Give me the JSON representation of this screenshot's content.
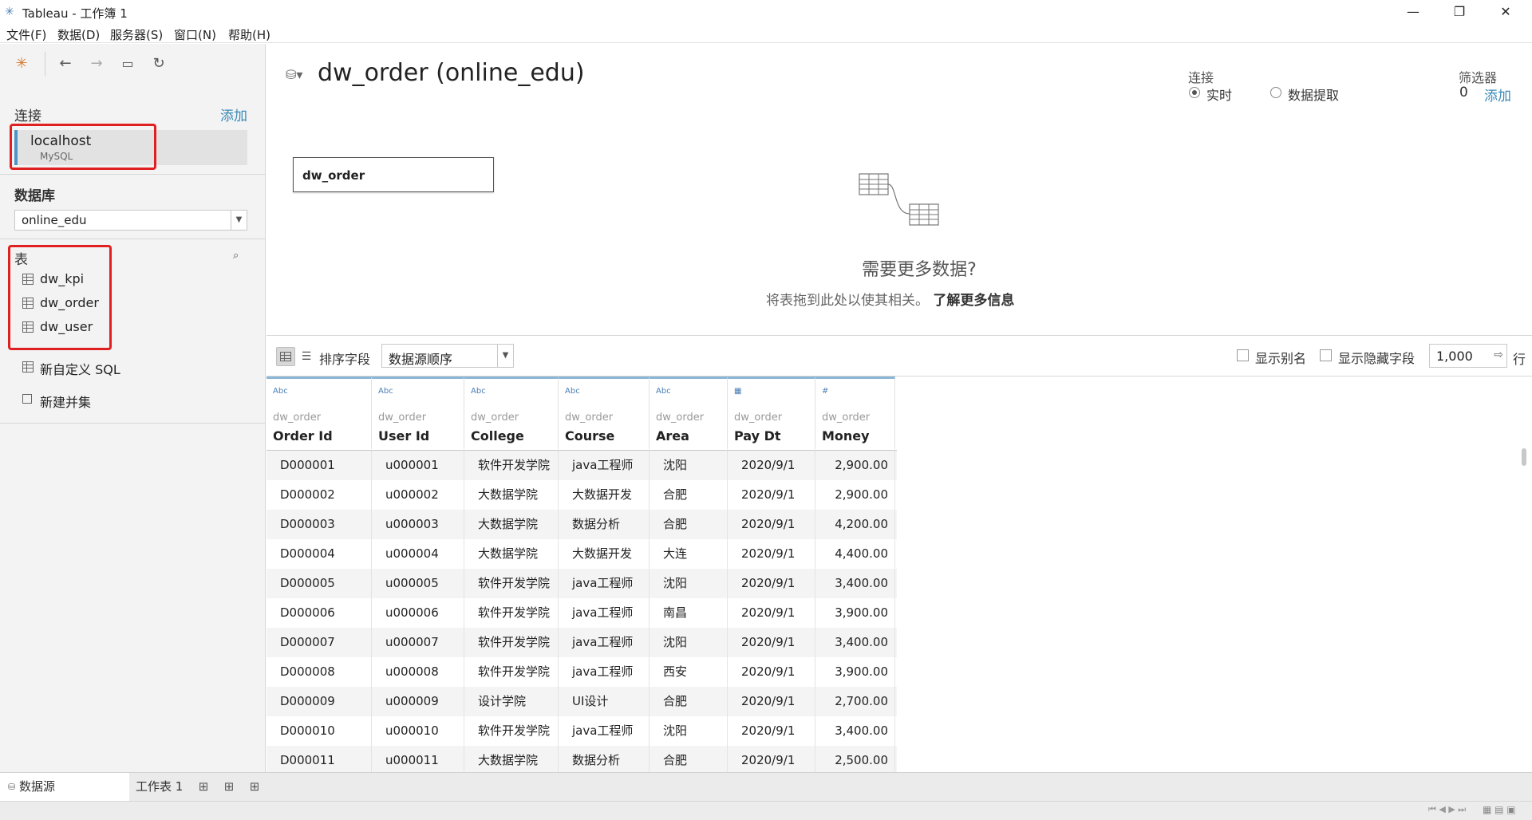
{
  "window": {
    "title": "Tableau - 工作簿 1",
    "minimize": "—",
    "restore": "❐",
    "close": "✕"
  },
  "menu": [
    "文件(F)",
    "数据(D)",
    "服务器(S)",
    "窗口(N)",
    "帮助(H)"
  ],
  "sidebar": {
    "connections_heading": "连接",
    "add_label": "添加",
    "connection": {
      "name": "localhost",
      "type": "MySQL"
    },
    "database_heading": "数据库",
    "database_value": "online_edu",
    "tables_heading": "表",
    "tables": [
      "dw_kpi",
      "dw_order",
      "dw_user"
    ],
    "custom_sql": "新自定义 SQL",
    "new_union": "新建并集"
  },
  "canvas": {
    "title": "dw_order (online_edu)",
    "connection_label": "连接",
    "live_label": "实时",
    "extract_label": "数据提取",
    "filters_label": "筛选器",
    "filters_count": "0",
    "filters_add": "添加",
    "table_box": "dw_order",
    "need_more": "需要更多数据?",
    "drag_hint": "将表拖到此处以使其相关。",
    "learn_more": "了解更多信息"
  },
  "grid_toolbar": {
    "sort_label": "排序字段",
    "sort_value": "数据源顺序",
    "show_alias": "显示别名",
    "show_hidden": "显示隐藏字段",
    "rows_value": "1,000",
    "rows_unit": "行"
  },
  "columns": [
    {
      "type": "Abc",
      "source": "dw_order",
      "name": "Order Id"
    },
    {
      "type": "Abc",
      "source": "dw_order",
      "name": "User Id"
    },
    {
      "type": "Abc",
      "source": "dw_order",
      "name": "College"
    },
    {
      "type": "Abc",
      "source": "dw_order",
      "name": "Course"
    },
    {
      "type": "Abc",
      "source": "dw_order",
      "name": "Area"
    },
    {
      "type": "▦",
      "source": "dw_order",
      "name": "Pay Dt"
    },
    {
      "type": "#",
      "source": "dw_order",
      "name": "Money"
    }
  ],
  "rows": [
    [
      "D000001",
      "u000001",
      "软件开发学院",
      "java工程师",
      "沈阳",
      "2020/9/1",
      "2,900.00"
    ],
    [
      "D000002",
      "u000002",
      "大数据学院",
      "大数据开发",
      "合肥",
      "2020/9/1",
      "2,900.00"
    ],
    [
      "D000003",
      "u000003",
      "大数据学院",
      "数据分析",
      "合肥",
      "2020/9/1",
      "4,200.00"
    ],
    [
      "D000004",
      "u000004",
      "大数据学院",
      "大数据开发",
      "大连",
      "2020/9/1",
      "4,400.00"
    ],
    [
      "D000005",
      "u000005",
      "软件开发学院",
      "java工程师",
      "沈阳",
      "2020/9/1",
      "3,400.00"
    ],
    [
      "D000006",
      "u000006",
      "软件开发学院",
      "java工程师",
      "南昌",
      "2020/9/1",
      "3,900.00"
    ],
    [
      "D000007",
      "u000007",
      "软件开发学院",
      "java工程师",
      "沈阳",
      "2020/9/1",
      "3,400.00"
    ],
    [
      "D000008",
      "u000008",
      "软件开发学院",
      "java工程师",
      "西安",
      "2020/9/1",
      "3,900.00"
    ],
    [
      "D000009",
      "u000009",
      "设计学院",
      "UI设计",
      "合肥",
      "2020/9/1",
      "2,700.00"
    ],
    [
      "D000010",
      "u000010",
      "软件开发学院",
      "java工程师",
      "沈阳",
      "2020/9/1",
      "3,400.00"
    ],
    [
      "D000011",
      "u000011",
      "大数据学院",
      "数据分析",
      "合肥",
      "2020/9/1",
      "2,500.00"
    ]
  ],
  "tabs": {
    "datasource": "数据源",
    "sheet1": "工作表 1"
  },
  "colors": {
    "accent": "#3a8ab8",
    "highlight_outline": "#e02020"
  }
}
